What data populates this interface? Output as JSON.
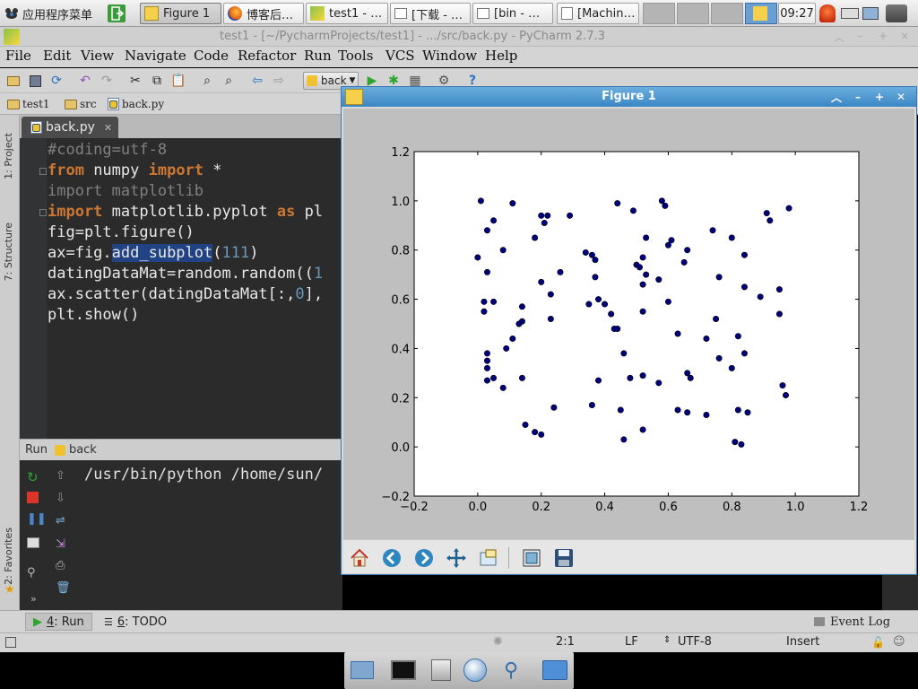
{
  "taskbar": {
    "menu_label": "应用程序菜单",
    "tasks": [
      "Figure 1",
      "博客后…",
      "test1 - …",
      "[下载 - …",
      "[bin - …",
      "[Machin…"
    ],
    "clock": "09:27"
  },
  "ide": {
    "title": "test1 - [~/PycharmProjects/test1] - .../src/back.py - PyCharm 2.7.3",
    "menu": [
      "File",
      "Edit",
      "View",
      "Navigate",
      "Code",
      "Refactor",
      "Run",
      "Tools",
      "VCS",
      "Window",
      "Help"
    ],
    "run_config": "back",
    "breadcrumbs": [
      "test1",
      "src",
      "back.py"
    ],
    "editor_tab": "back.py",
    "left_tabs": [
      "1: Project",
      "7: Structure",
      "2: Favorites"
    ],
    "code": {
      "l1": "#coding=utf-8",
      "l2_from": "from",
      "l2_mod": " numpy ",
      "l2_import": "import",
      "l2_rest": " *",
      "l3": "import matplotlib",
      "l4_import": "import",
      "l4_mod": " matplotlib.pyplot ",
      "l4_as": "as",
      "l4_rest": " pl",
      "l5": "fig=plt.figure()",
      "l6_pre": "ax=fig.",
      "l6_sel": "add_subplot",
      "l6_open": "(",
      "l6_num": "111",
      "l6_close": ")",
      "l7_pre": "datingDataMat=random.random((",
      "l7_num": "1",
      "l8_pre": "ax.scatter(datingDataMat[:,",
      "l8_num": "0",
      "l8_rest": "],",
      "l9": "plt.show()"
    },
    "run_panel": {
      "label": "Run",
      "config": "back",
      "output": "/usr/bin/python /home/sun/"
    },
    "bottom_tabs": {
      "run_num": "4",
      "run_label": ": Run",
      "todo_num": "6",
      "todo_label": ": TODO",
      "event_log": "Event Log"
    },
    "status": {
      "position": "2:1",
      "line_sep": "LF",
      "encoding": "UTF-8",
      "mode": "Insert"
    }
  },
  "figure": {
    "title": "Figure 1",
    "toolbar": [
      "home-icon",
      "back-icon",
      "forward-icon",
      "pan-icon",
      "zoom-icon",
      "subplots-icon",
      "save-icon"
    ]
  },
  "chart_data": {
    "type": "scatter",
    "title": "",
    "xlabel": "",
    "ylabel": "",
    "xlim": [
      -0.2,
      1.2
    ],
    "ylim": [
      -0.2,
      1.2
    ],
    "xticks": [
      "−0.2",
      "0.0",
      "0.2",
      "0.4",
      "0.6",
      "0.8",
      "1.0",
      "1.2"
    ],
    "yticks": [
      "−0.2",
      "0.0",
      "0.2",
      "0.4",
      "0.6",
      "0.8",
      "1.0",
      "1.2"
    ],
    "grid": false,
    "marker_color": "#00007f",
    "points": [
      [
        0.01,
        1.0
      ],
      [
        0.11,
        0.99
      ],
      [
        0.44,
        0.99
      ],
      [
        0.58,
        1.0
      ],
      [
        0.59,
        0.98
      ],
      [
        0.98,
        0.97
      ],
      [
        0.91,
        0.95
      ],
      [
        0.49,
        0.96
      ],
      [
        0.2,
        0.94
      ],
      [
        0.22,
        0.94
      ],
      [
        0.29,
        0.94
      ],
      [
        0.05,
        0.92
      ],
      [
        0.92,
        0.92
      ],
      [
        0.21,
        0.91
      ],
      [
        0.03,
        0.88
      ],
      [
        0.74,
        0.88
      ],
      [
        0.18,
        0.85
      ],
      [
        0.53,
        0.85
      ],
      [
        0.8,
        0.85
      ],
      [
        0.61,
        0.84
      ],
      [
        0.6,
        0.82
      ],
      [
        0.08,
        0.8
      ],
      [
        0.66,
        0.8
      ],
      [
        0.34,
        0.79
      ],
      [
        0.36,
        0.78
      ],
      [
        0.0,
        0.77
      ],
      [
        0.84,
        0.78
      ],
      [
        0.52,
        0.77
      ],
      [
        0.37,
        0.76
      ],
      [
        0.65,
        0.75
      ],
      [
        0.5,
        0.74
      ],
      [
        0.51,
        0.73
      ],
      [
        0.03,
        0.71
      ],
      [
        0.26,
        0.71
      ],
      [
        0.53,
        0.7
      ],
      [
        0.37,
        0.69
      ],
      [
        0.76,
        0.69
      ],
      [
        0.57,
        0.68
      ],
      [
        0.2,
        0.67
      ],
      [
        0.52,
        0.66
      ],
      [
        0.84,
        0.65
      ],
      [
        0.95,
        0.64
      ],
      [
        0.23,
        0.62
      ],
      [
        0.89,
        0.61
      ],
      [
        0.38,
        0.6
      ],
      [
        0.02,
        0.59
      ],
      [
        0.05,
        0.59
      ],
      [
        0.6,
        0.59
      ],
      [
        0.35,
        0.58
      ],
      [
        0.4,
        0.58
      ],
      [
        0.14,
        0.57
      ],
      [
        0.02,
        0.55
      ],
      [
        0.52,
        0.55
      ],
      [
        0.42,
        0.54
      ],
      [
        0.95,
        0.54
      ],
      [
        0.75,
        0.52
      ],
      [
        0.23,
        0.52
      ],
      [
        0.14,
        0.51
      ],
      [
        0.13,
        0.5
      ],
      [
        0.44,
        0.48
      ],
      [
        0.43,
        0.48
      ],
      [
        0.63,
        0.46
      ],
      [
        0.82,
        0.45
      ],
      [
        0.11,
        0.44
      ],
      [
        0.72,
        0.44
      ],
      [
        0.09,
        0.4
      ],
      [
        0.46,
        0.38
      ],
      [
        0.84,
        0.38
      ],
      [
        0.03,
        0.38
      ],
      [
        0.03,
        0.35
      ],
      [
        0.76,
        0.36
      ],
      [
        0.03,
        0.32
      ],
      [
        0.8,
        0.32
      ],
      [
        0.66,
        0.3
      ],
      [
        0.52,
        0.29
      ],
      [
        0.48,
        0.28
      ],
      [
        0.05,
        0.28
      ],
      [
        0.14,
        0.28
      ],
      [
        0.67,
        0.28
      ],
      [
        0.38,
        0.27
      ],
      [
        0.03,
        0.27
      ],
      [
        0.57,
        0.26
      ],
      [
        0.96,
        0.25
      ],
      [
        0.08,
        0.24
      ],
      [
        0.97,
        0.21
      ],
      [
        0.36,
        0.17
      ],
      [
        0.24,
        0.16
      ],
      [
        0.45,
        0.15
      ],
      [
        0.63,
        0.15
      ],
      [
        0.82,
        0.15
      ],
      [
        0.66,
        0.14
      ],
      [
        0.85,
        0.14
      ],
      [
        0.72,
        0.13
      ],
      [
        0.15,
        0.09
      ],
      [
        0.52,
        0.07
      ],
      [
        0.18,
        0.06
      ],
      [
        0.2,
        0.05
      ],
      [
        0.46,
        0.03
      ],
      [
        0.81,
        0.02
      ],
      [
        0.83,
        0.01
      ]
    ]
  }
}
